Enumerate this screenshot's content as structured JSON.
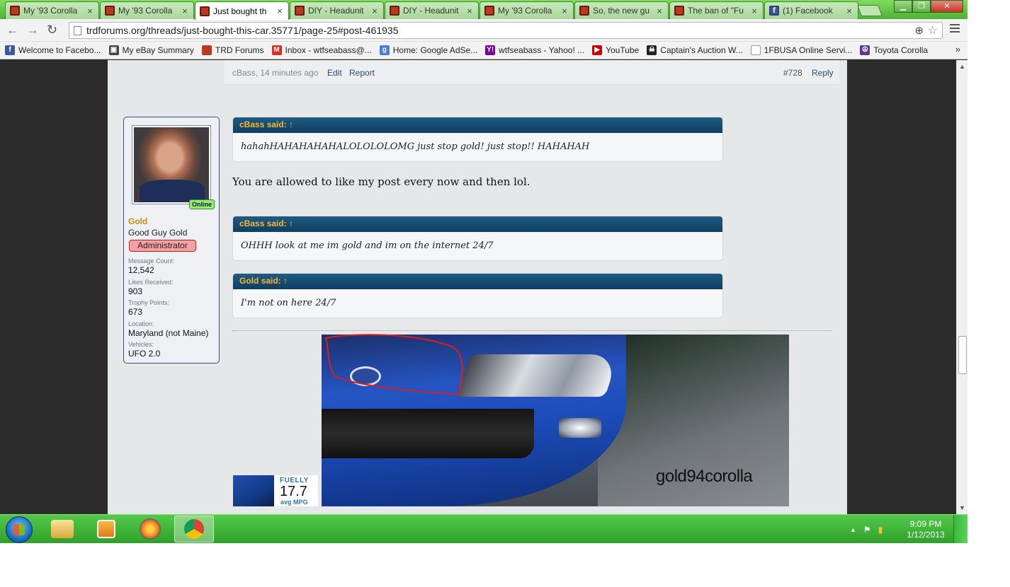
{
  "tabs": [
    {
      "title": "My '93 Corolla",
      "fav": "trd"
    },
    {
      "title": "My '93 Corolla",
      "fav": "trd"
    },
    {
      "title": "Just bought th",
      "fav": "trd",
      "active": true
    },
    {
      "title": "DIY - Headunit",
      "fav": "trd"
    },
    {
      "title": "DIY - Headunit",
      "fav": "trd"
    },
    {
      "title": "My '93 Corolla",
      "fav": "trd"
    },
    {
      "title": "So, the new gu",
      "fav": "trd"
    },
    {
      "title": "The ban of \"Fu",
      "fav": "trd"
    },
    {
      "title": "(1) Facebook",
      "fav": "fb"
    }
  ],
  "close_glyph": "×",
  "window_buttons": {
    "minimize": "▁",
    "maximize": "❐",
    "close": "✕"
  },
  "nav": {
    "back": "←",
    "forward": "→",
    "reload": "↻"
  },
  "url": "trdforums.org/threads/just-bought-this-car.35771/page-25#post-461935",
  "omnibox_icons": {
    "zoom": "⊕",
    "star": "☆"
  },
  "bookmarks": [
    {
      "label": "Welcome to Facebo...",
      "icon": "f",
      "color": "#3b5998"
    },
    {
      "label": "My eBay Summary",
      "icon": "▣",
      "color": "#444"
    },
    {
      "label": "TRD Forums",
      "icon": "",
      "color": "#b83a1f"
    },
    {
      "label": "Inbox - wtfseabass@...",
      "icon": "M",
      "color": "#d93025"
    },
    {
      "label": "Home: Google AdSe...",
      "icon": "g",
      "color": "#4a7de0"
    },
    {
      "label": "wtfseabass - Yahoo! ...",
      "icon": "Y!",
      "color": "#7b0099"
    },
    {
      "label": "YouTube",
      "icon": "▶",
      "color": "#cc0000"
    },
    {
      "label": "Captain's Auction W...",
      "icon": "☠",
      "color": "#222"
    },
    {
      "label": "1FBUSA Online Servi...",
      "icon": "",
      "color": "#fff"
    },
    {
      "label": "Toyota Corolla",
      "icon": "☮",
      "color": "#5a3a8a"
    }
  ],
  "bookmarks_more": "»",
  "prev_message": {
    "meta": "cBass, 14 minutes ago",
    "edit": "Edit",
    "report": "Report",
    "number": "#728",
    "reply": "Reply"
  },
  "user": {
    "online": "Online",
    "name": "Gold",
    "title": "Good Guy Gold",
    "badge": "Administrator",
    "stats": [
      {
        "label": "Message Count:",
        "value": "12,542"
      },
      {
        "label": "Likes Received:",
        "value": "903"
      },
      {
        "label": "Trophy Points:",
        "value": "673"
      },
      {
        "label": "Location:",
        "value": "Maryland (not Maine)"
      },
      {
        "label": "Vehicles:",
        "value": "UFO 2.0"
      }
    ]
  },
  "quotes": [
    {
      "author": "cBass said: ↑",
      "text": "hahahHAHAHAHAHALOLOLOLOMG just stop gold! just stop!! HAHAHAH"
    },
    {
      "author": "cBass said: ↑",
      "text": "OHHH look at me im gold and im on the internet 24/7"
    },
    {
      "author": "Gold said: ↑",
      "text": "I'm not on here 24/7"
    }
  ],
  "message_text": "You are allowed to like my post every now and then lol.",
  "signature": {
    "watermark": "gold94corolla",
    "fuelly_brand": "FUELLY",
    "fuelly_value": "17.7",
    "fuelly_unit": "avg MPG"
  },
  "scrollbar": {
    "up": "▲",
    "down": "▼"
  },
  "tray": {
    "arrow": "▲",
    "flag": "⚑",
    "signal": "▮"
  },
  "clock": {
    "time": "9:09 PM",
    "date": "1/12/2013"
  },
  "colors": {
    "accent_tab": "#4eb236",
    "quote_header": "#0d3f60",
    "username": "#c98c0b",
    "annotation": "#d81e1e"
  }
}
